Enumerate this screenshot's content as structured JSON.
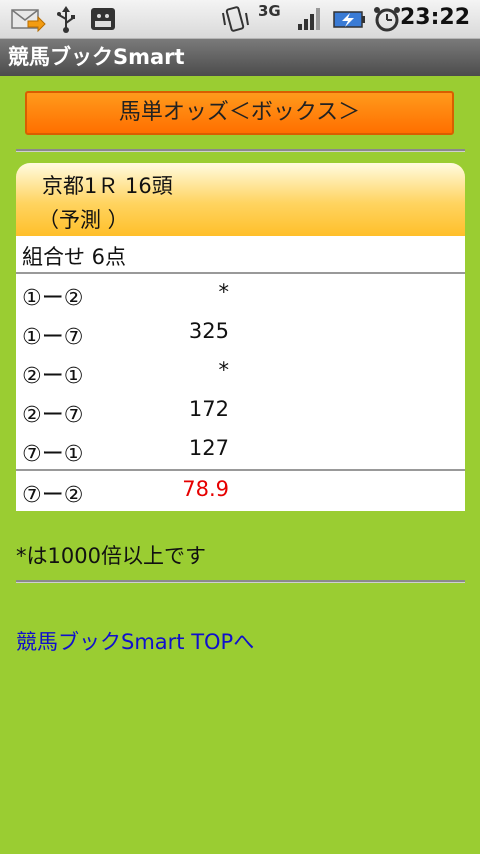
{
  "status_bar": {
    "time": "23:22",
    "network": "3G",
    "icons": [
      "mail-icon",
      "usb-icon",
      "android-debug-icon",
      "vibrate-icon",
      "signal-icon",
      "battery-charging-icon",
      "alarm-icon"
    ]
  },
  "app": {
    "title": "競馬ブックSmart"
  },
  "header": {
    "label": "馬単オッズ＜ボックス＞"
  },
  "race": {
    "name": "京都1Ｒ 16頭",
    "note": "（予測 ）"
  },
  "table": {
    "header": "組合せ 6点",
    "rows": [
      {
        "combo": "①ー②",
        "value": "*"
      },
      {
        "combo": "①ー⑦",
        "value": "325"
      },
      {
        "combo": "②ー①",
        "value": "*"
      },
      {
        "combo": "②ー⑦",
        "value": "172"
      },
      {
        "combo": "⑦ー①",
        "value": "127"
      },
      {
        "combo": "⑦ー②",
        "value": "78.9"
      }
    ]
  },
  "footnote": "*は1000倍以上です",
  "link": {
    "top": "競馬ブックSmart TOPへ"
  },
  "colors": {
    "background": "#9acd32",
    "header": "#ff7f00",
    "lowest_odds": "#e60000",
    "link": "#1010cc"
  }
}
